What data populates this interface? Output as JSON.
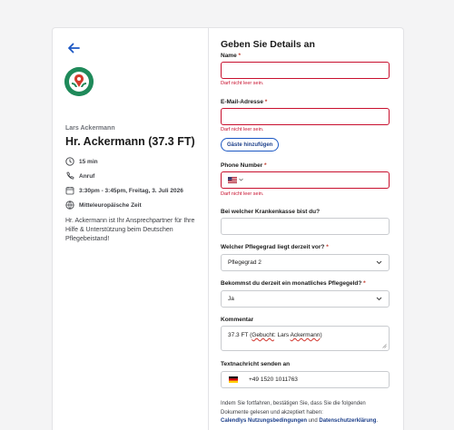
{
  "host": {
    "name": "Lars Ackermann",
    "event_title": "Hr. Ackermann (37.3 FT)",
    "description": "Hr. Ackermann ist Ihr Ansprechpartner für Ihre Hilfe & Unterstützung beim Deutschen Pflegebeistand!"
  },
  "meta": {
    "duration": "15 min",
    "type": "Anruf",
    "datetime": "3:30pm - 3:45pm, Freitag, 3. Juli 2026",
    "timezone": "Mitteleuropäische Zeit"
  },
  "form": {
    "title": "Geben Sie Details an",
    "name_label": "Name",
    "email_label": "E-Mail-Adresse",
    "required_marker": "*",
    "error_text": "Darf nicht leer sein.",
    "add_guests": "Gäste hinzufügen",
    "phone_label": "Phone Number",
    "insurance_label": "Bei welcher Krankenkasse bist du?",
    "care_level_label": "Welcher Pflegegrad liegt derzeit vor?",
    "care_level_value": "Pflegegrad 2",
    "allowance_label": "Bekommst du derzeit ein monatliches Pflegegeld?",
    "allowance_value": "Ja",
    "comment_label": "Kommentar",
    "comment_prefix": "37.3 FT (",
    "comment_word1": "Gebucht",
    "comment_mid": ": Lars ",
    "comment_word2": "Ackermann",
    "comment_suffix": ")",
    "sms_label": "Textnachricht senden an",
    "sms_number": "+49 1520 1011763",
    "consent_text": "Indem Sie fortfahren, bestätigen Sie, dass Sie die folgenden Dokumente gelesen und akzeptiert haben:",
    "terms_link": "Calendlys Nutzungsbedingungen",
    "consent_and": " und ",
    "privacy_link": "Datenschutzerklärung",
    "consent_end": "."
  },
  "icons": [
    "back-arrow-icon",
    "clock-icon",
    "phone-icon",
    "calendar-icon",
    "globe-icon",
    "us-flag-icon",
    "de-flag-icon",
    "chevron-down-icon"
  ],
  "colors": {
    "accent": "#1c58c4",
    "error": "#c8102e",
    "logo": "#1f8a5a"
  }
}
